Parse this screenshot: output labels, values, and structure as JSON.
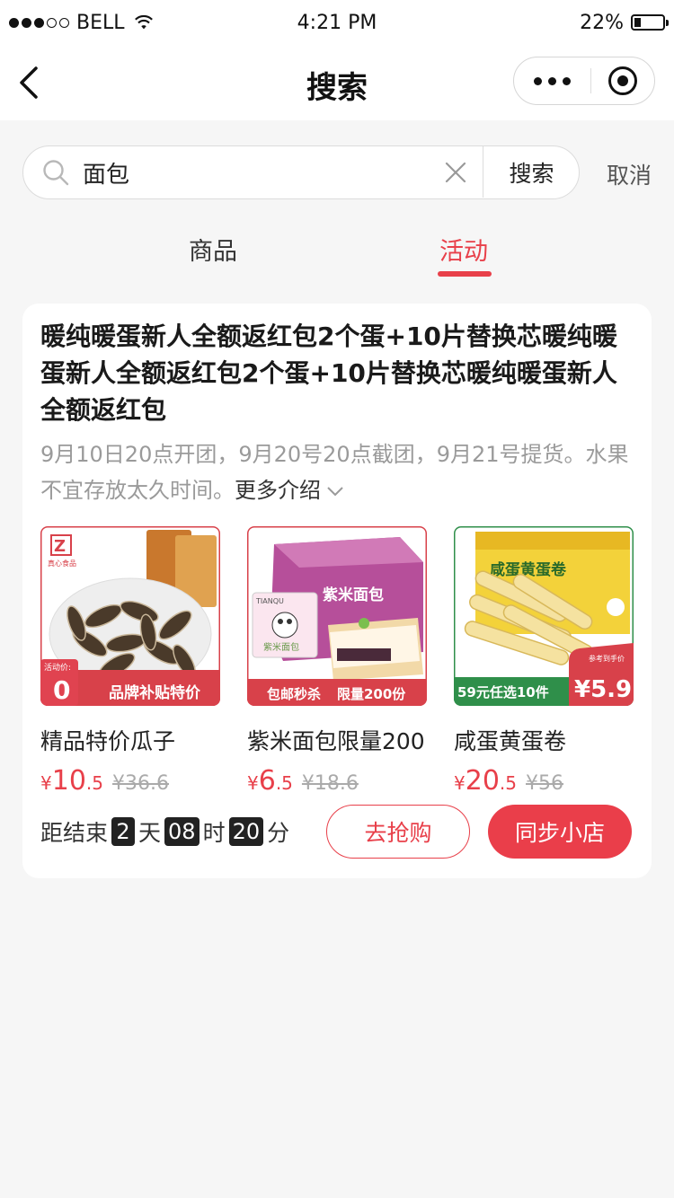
{
  "status_bar": {
    "carrier": "BELL",
    "time": "4:21 PM",
    "battery": "22%",
    "battery_level": 0.22
  },
  "nav": {
    "title": "搜索"
  },
  "search": {
    "value": "面包",
    "button_label": "搜索",
    "cancel_label": "取消"
  },
  "tabs": [
    {
      "label": "商品",
      "active": false
    },
    {
      "label": "活动",
      "active": true
    }
  ],
  "card": {
    "title": "暖纯暖蛋新人全额返红包2个蛋+10片替换芯暖纯暖蛋新人全额返红包2个蛋+10片替换芯暖纯暖蛋新人全额返红包",
    "description": "9月10日20点开团，9月20号20点截团，9月21号提货。水果不宜存放太久时间。",
    "more_label": "更多介绍",
    "products": [
      {
        "name": "精品特价瓜子",
        "price_symbol": "¥",
        "price_int": "10",
        "price_dec": ".5",
        "original_price": "¥36.6",
        "image_texts": {
          "brand": "真心食品",
          "badge_label": "活动价:",
          "badge_value": "0",
          "banner": "品牌补贴特价"
        }
      },
      {
        "name": "紫米面包限量200",
        "price_symbol": "¥",
        "price_int": "6",
        "price_dec": ".5",
        "original_price": "¥18.6",
        "image_texts": {
          "box": "紫米面包",
          "bag": "紫米面包",
          "brand": "TIANQU",
          "banner_left": "包邮秒杀",
          "banner_right": "限量200份"
        }
      },
      {
        "name": "咸蛋黄蛋卷",
        "price_symbol": "¥",
        "price_int": "20",
        "price_dec": ".5",
        "original_price": "¥56",
        "image_texts": {
          "box": "咸蛋黄蛋卷",
          "banner": "59元任选10件",
          "ref_label": "参考到手价",
          "ref_price": "¥5.9"
        }
      }
    ],
    "countdown": {
      "prefix": "距结束",
      "days": "2",
      "days_unit": "天",
      "hours": "08",
      "hours_unit": "时",
      "minutes": "20",
      "minutes_unit": "分"
    },
    "grab_button": "去抢购",
    "sync_button": "同步小店"
  },
  "colors": {
    "accent": "#e8404a",
    "background": "#f6f6f6"
  }
}
